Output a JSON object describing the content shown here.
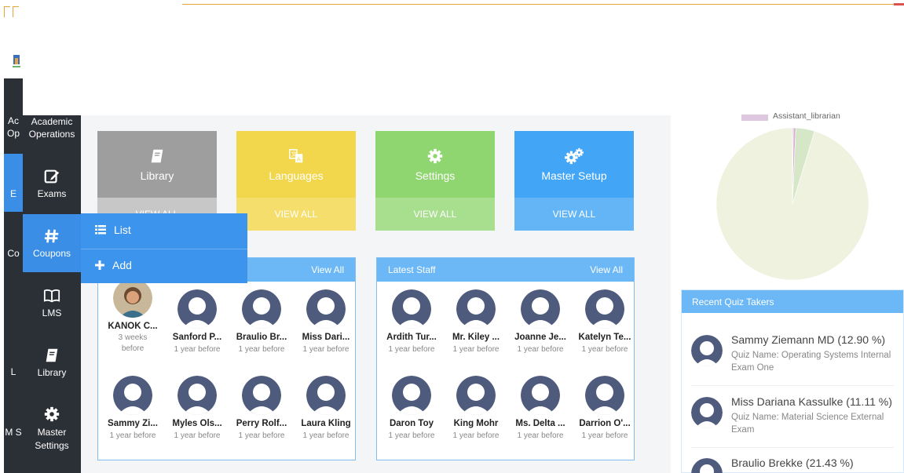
{
  "sidebar": {
    "items": [
      {
        "label": "Academic Operations",
        "icon": "academic-icon",
        "partial": "Ac Op"
      },
      {
        "label": "Exams",
        "icon": "edit-icon",
        "partial": "E"
      },
      {
        "label": "Coupons",
        "icon": "hash-icon",
        "partial": "Co"
      },
      {
        "label": "LMS",
        "icon": "book-open-icon",
        "partial": ""
      },
      {
        "label": "Library",
        "icon": "book-icon",
        "partial": "L"
      },
      {
        "label": "Master Settings",
        "icon": "gear-icon",
        "partial": "M S"
      }
    ],
    "flyout": {
      "list_label": "List",
      "add_label": "Add"
    }
  },
  "cards": [
    {
      "label": "Library",
      "action": "VIEW ALL",
      "color": "#9e9e9e",
      "color_bottom": "#c7c7c7",
      "icon": "book-icon"
    },
    {
      "label": "Languages",
      "action": "VIEW ALL",
      "color": "#f2d64b",
      "color_bottom": "#f5de6c",
      "icon": "translate-icon"
    },
    {
      "label": "Settings",
      "action": "VIEW ALL",
      "color": "#8fd670",
      "color_bottom": "#a8df8e",
      "icon": "gear-icon"
    },
    {
      "label": "Master Setup",
      "action": "VIEW ALL",
      "color": "#42a5f5",
      "color_bottom": "#64b5f6",
      "icon": "gears-icon"
    }
  ],
  "students_panel": {
    "view_all": "View All",
    "people": [
      {
        "name": "KANOK C...",
        "time": "3 weeks before",
        "photo": true
      },
      {
        "name": "Sanford P...",
        "time": "1 year before"
      },
      {
        "name": "Braulio Br...",
        "time": "1 year before"
      },
      {
        "name": "Miss Dari...",
        "time": "1 year before"
      },
      {
        "name": "Sammy Zi...",
        "time": "1 year before"
      },
      {
        "name": "Myles Ols...",
        "time": "1 year before"
      },
      {
        "name": "Perry Rolf...",
        "time": "1 year before"
      },
      {
        "name": "Laura Kling",
        "time": "1 year before"
      }
    ]
  },
  "staff_panel": {
    "title": "Latest Staff",
    "view_all": "View All",
    "people": [
      {
        "name": "Ardith Tur...",
        "time": "1 year before"
      },
      {
        "name": "Mr. Kiley ...",
        "time": "1 year before"
      },
      {
        "name": "Joanne Je...",
        "time": "1 year before"
      },
      {
        "name": "Katelyn Te...",
        "time": "1 year before"
      },
      {
        "name": "Daron Toy",
        "time": "1 year before"
      },
      {
        "name": "King Mohr",
        "time": "1 year before"
      },
      {
        "name": "Ms. Delta ...",
        "time": "1 year before"
      },
      {
        "name": "Darrion O'...",
        "time": "1 year before"
      }
    ]
  },
  "pie": {
    "legend": "Assistant_librarian",
    "legend_color": "#ddc8e0",
    "slices": [
      {
        "color": "#eef2de",
        "value": 0.953
      },
      {
        "color": "#b8b8b8",
        "value": 0.002
      },
      {
        "color": "#d8aed4",
        "value": 0.005
      },
      {
        "color": "#d6e7c8",
        "value": 0.04
      }
    ]
  },
  "quiz": {
    "title": "Recent Quiz Takers",
    "entries": [
      {
        "name": "Sammy Ziemann MD (12.90 %)",
        "quiz": "Quiz Name: Operating Systems Internal Exam One"
      },
      {
        "name": "Miss Dariana Kassulke (11.11 %)",
        "quiz": "Quiz Name: Material Science External Exam"
      },
      {
        "name": "Braulio Brekke (21.43 %)",
        "quiz": ""
      }
    ]
  },
  "colors": {
    "accent": "#3a8ee6",
    "sidebar": "#2b2f36",
    "panel_head": "#6cb8f6",
    "avatar": "#4f5b7d"
  }
}
